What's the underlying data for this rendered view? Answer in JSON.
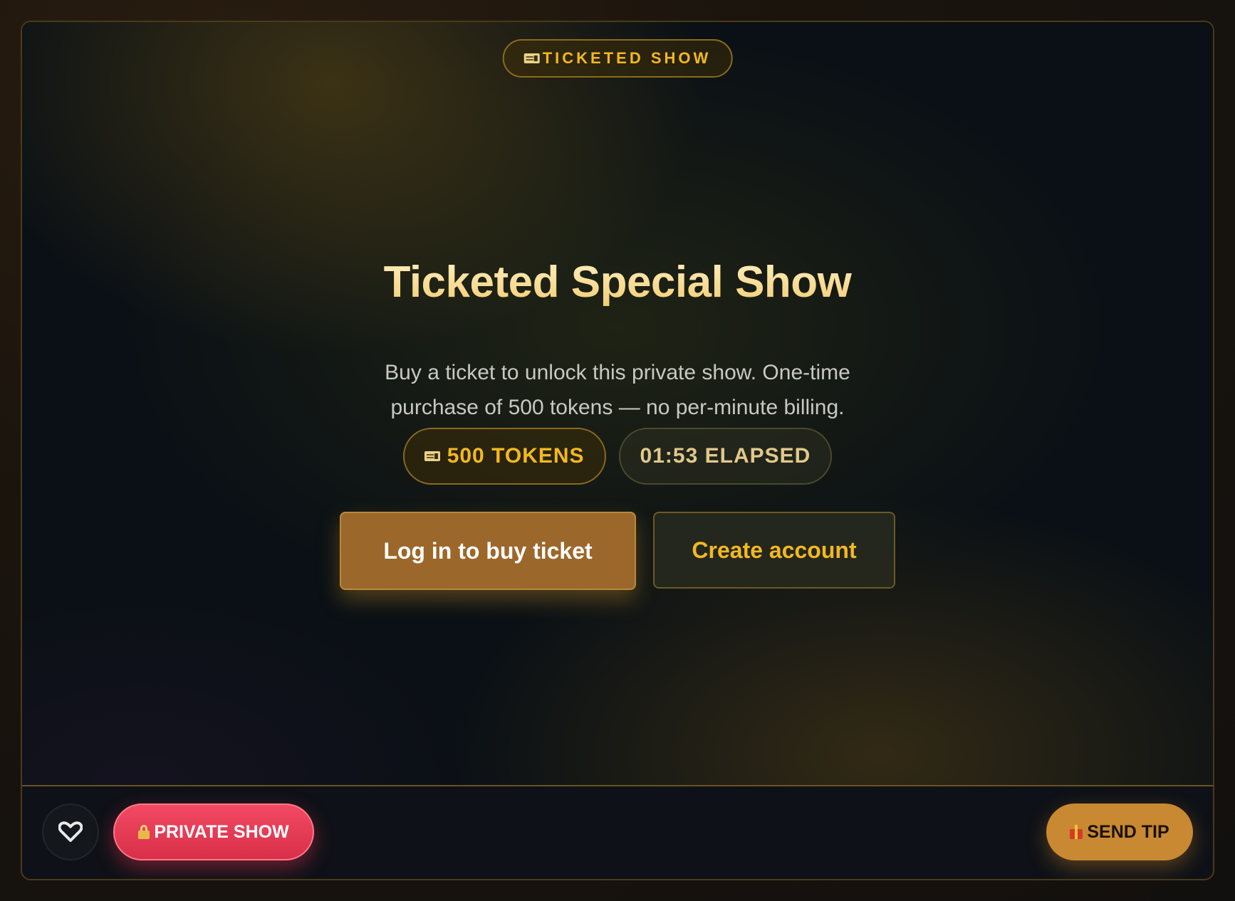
{
  "badge": {
    "label": "TICKETED SHOW",
    "icon": "ticket-icon"
  },
  "show": {
    "title": "Ticketed Special Show",
    "description": "Buy a ticket to unlock this private show. One-time purchase of 500 tokens — no per-minute billing.",
    "price_label": "500 TOKENS",
    "price_icon": "ticket-icon",
    "timer_label": "01:53 ELAPSED"
  },
  "actions": {
    "buy_label": "Log in to buy ticket",
    "create_label": "Create account"
  },
  "controls": {
    "favorite_icon": "heart-icon",
    "private_label": "PRIVATE SHOW",
    "private_icon": "lock-icon",
    "tip_label": "SEND TIP",
    "tip_icon": "gift-icon"
  },
  "colors": {
    "accent_gold": "#f3b821",
    "buy_button": "#9c672a",
    "private_button": "#e23a55",
    "tip_button": "#c98832"
  }
}
